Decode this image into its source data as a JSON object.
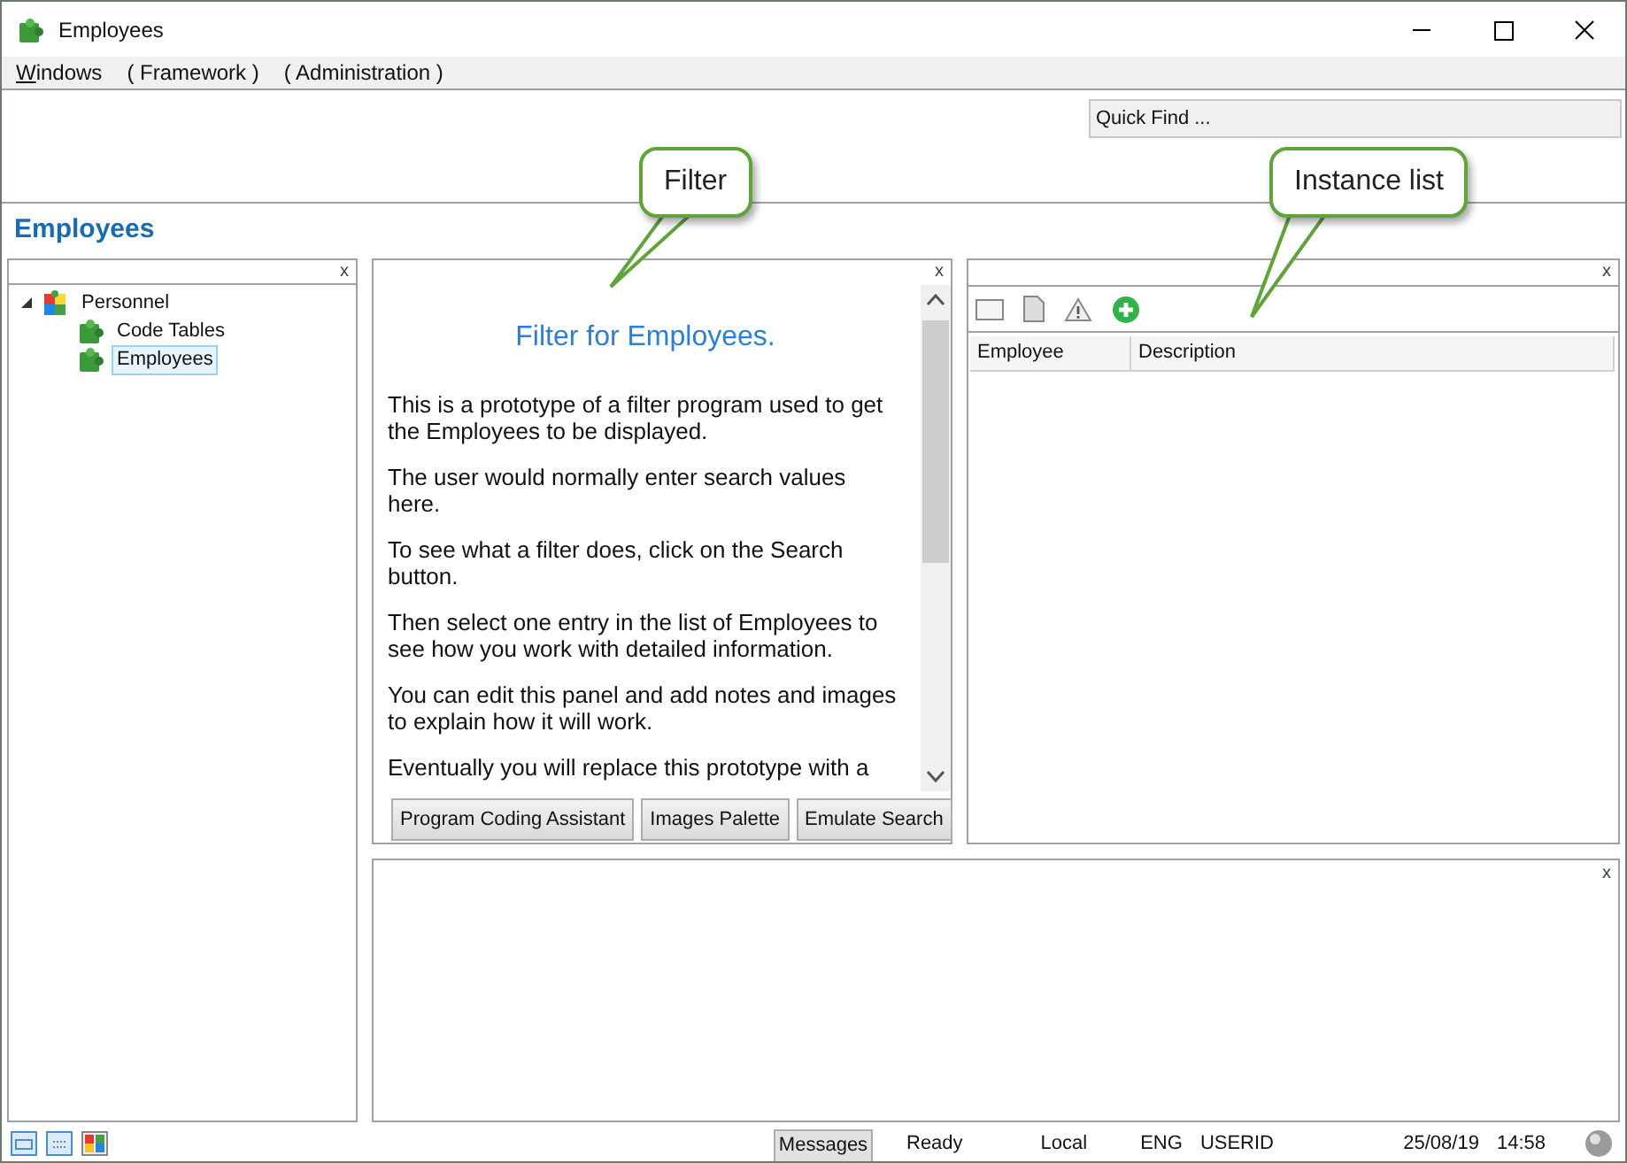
{
  "window": {
    "title": "Employees"
  },
  "menu": [
    {
      "label": "Windows",
      "first_letter_underlined": true
    },
    {
      "label": "( Framework )"
    },
    {
      "label": "( Administration )"
    }
  ],
  "quick_find": {
    "placeholder": "Quick Find ..."
  },
  "page_title": "Employees",
  "tree": [
    {
      "label": "Personnel",
      "expanded": true,
      "selected": false,
      "children": [
        {
          "label": "Code Tables",
          "selected": false
        },
        {
          "label": "Employees",
          "selected": true
        }
      ]
    }
  ],
  "filter_panel": {
    "close": "x",
    "heading": "Filter for Employees.",
    "paragraphs": [
      "This is a prototype of a filter program used to get the Employees to be displayed.",
      "The user would normally enter search values here.",
      "To see what a filter does, click on the Search button.",
      "Then select one entry in the list of Employees to see how you work with detailed information.",
      "You can edit this panel and add notes and images to explain how it will work.",
      "Eventually you will replace this prototype with a"
    ],
    "buttons": [
      "Program Coding Assistant",
      "Images Palette",
      "Emulate Search"
    ]
  },
  "tree_panel": {
    "close": "x"
  },
  "instance_panel": {
    "close": "x",
    "columns": [
      "Employee",
      "Description"
    ]
  },
  "bottom_panel": {
    "close": "x"
  },
  "callouts": [
    {
      "text": "Filter"
    },
    {
      "text": "Instance list"
    }
  ],
  "status_bar": {
    "messages": "Messages",
    "state": "Ready",
    "location": "Local",
    "language": "ENG",
    "user": "USERID",
    "date": "25/08/19",
    "time": "14:58"
  }
}
